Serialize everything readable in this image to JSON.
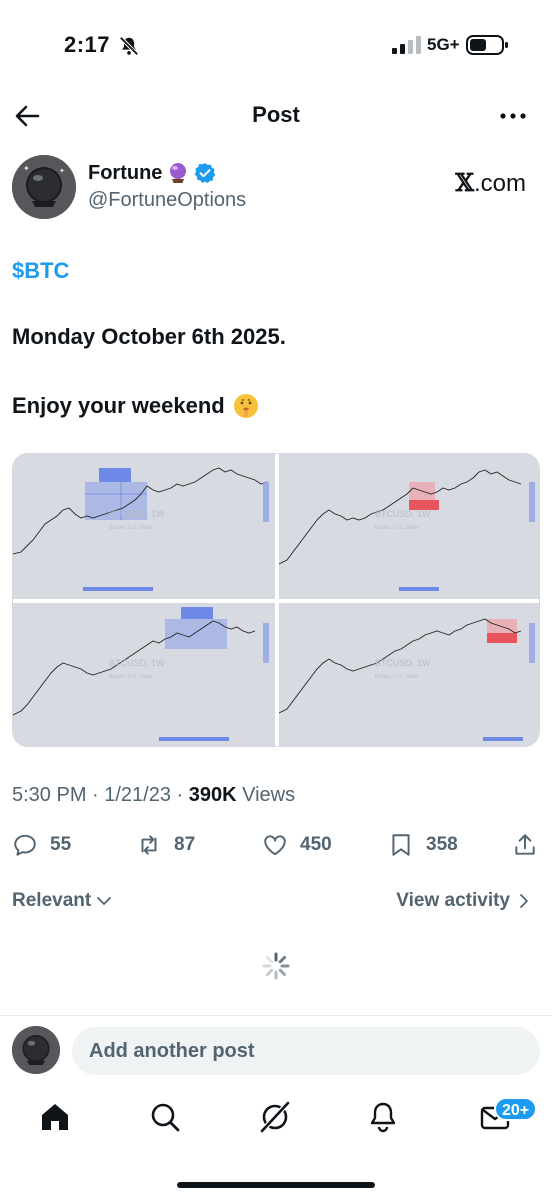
{
  "status_bar": {
    "time": "2:17",
    "network": "5G+"
  },
  "header": {
    "title": "Post"
  },
  "author": {
    "name": "Fortune",
    "handle": "@FortuneOptions",
    "source": "𝕏.com",
    "source_x": "𝕏",
    "source_rest": ".com"
  },
  "post": {
    "ticker": "$BTC",
    "line1": "Monday October 6th 2025.",
    "line2": "Enjoy your weekend"
  },
  "media": {
    "charts": [
      {
        "symbol": "BTCUSD, 1W",
        "subtitle": "Bitcoin / U.S. Dollar"
      },
      {
        "symbol": "BTCUSD, 1W",
        "subtitle": "Bitcoin / U.S. Dollar"
      },
      {
        "symbol": "BTCUSD, 1W",
        "subtitle": "Bitcoin / U.S. Dollar"
      },
      {
        "symbol": "BTCUSD, 1W",
        "subtitle": "Bitcoin / U.S. Dollar"
      }
    ]
  },
  "meta": {
    "time_date": "5:30 PM · 1/21/23 · ",
    "views_count": "390K",
    "views_label": " Views"
  },
  "actions": {
    "replies": "55",
    "reposts": "87",
    "likes": "450",
    "bookmarks": "358"
  },
  "sort": {
    "relevant": "Relevant",
    "view_activity": "View activity"
  },
  "composer": {
    "placeholder": "Add another post"
  },
  "nav": {
    "messages_badge": "20+"
  },
  "colors": {
    "accent": "#1d9bf0",
    "text": "#0f1419",
    "secondary": "#536471"
  }
}
